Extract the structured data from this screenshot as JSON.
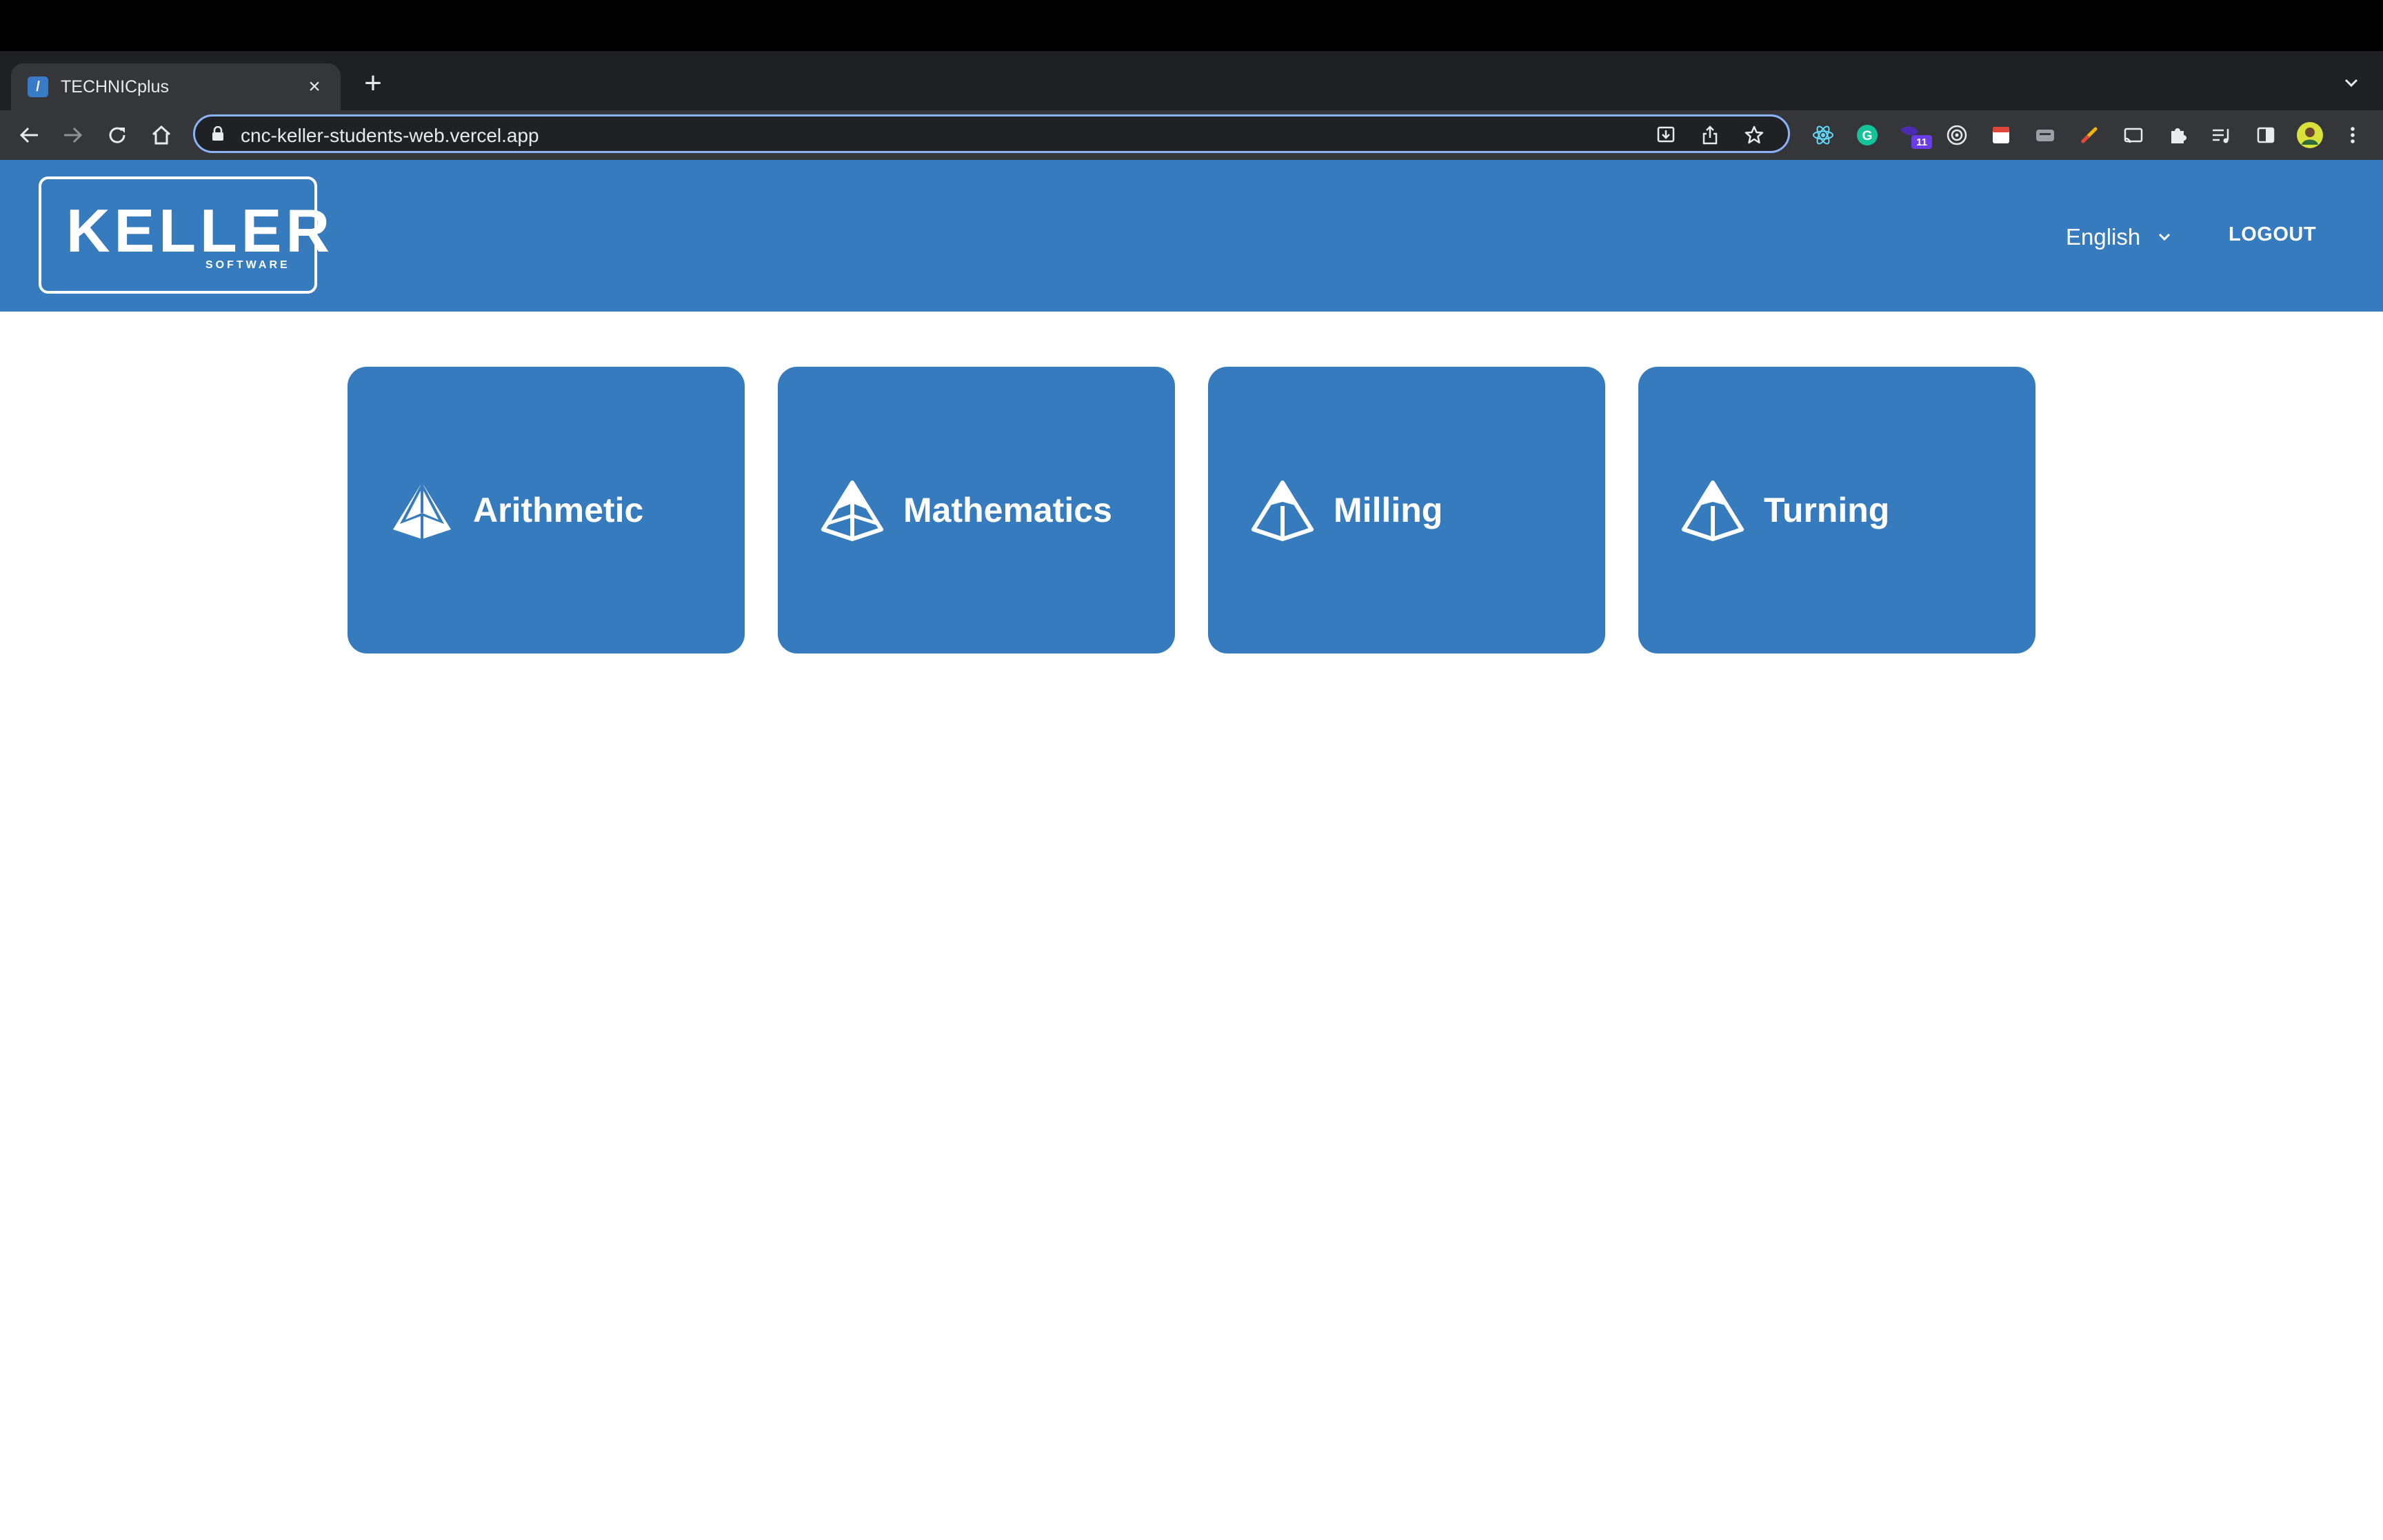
{
  "browser": {
    "tab": {
      "title": "TECHNICplus",
      "favicon": "keller-favicon",
      "close_icon": "close-icon"
    },
    "new_tab_icon": "plus-icon",
    "address_bar": {
      "url": "cnc-keller-students-web.vercel.app",
      "secure_icon": "lock-icon"
    },
    "extensions": [
      {
        "name": "react-devtools-icon"
      },
      {
        "name": "grammarly-icon"
      },
      {
        "name": "extension-badge-icon",
        "badge": "11"
      },
      {
        "name": "target-icon"
      },
      {
        "name": "calendar-icon"
      },
      {
        "name": "keyboard-icon"
      },
      {
        "name": "pen-icon"
      },
      {
        "name": "cast-icon"
      },
      {
        "name": "puzzle-icon"
      },
      {
        "name": "media-icon"
      },
      {
        "name": "side-panel-icon"
      },
      {
        "name": "profile-avatar"
      },
      {
        "name": "menu-icon"
      }
    ]
  },
  "header": {
    "logo": {
      "main": "KELLER",
      "sub": "SOFTWARE"
    },
    "language": {
      "selected": "English"
    },
    "logout_label": "LOGOUT"
  },
  "colors": {
    "primary": "#367bbd",
    "chrome_dark": "#35363a",
    "focus": "#8ab4f8"
  },
  "subjects": [
    {
      "label": "Arithmetic",
      "icon": "pyramid-icon"
    },
    {
      "label": "Mathematics",
      "icon": "pyramid-icon"
    },
    {
      "label": "Milling",
      "icon": "pyramid-icon"
    },
    {
      "label": "Turning",
      "icon": "pyramid-icon"
    }
  ]
}
